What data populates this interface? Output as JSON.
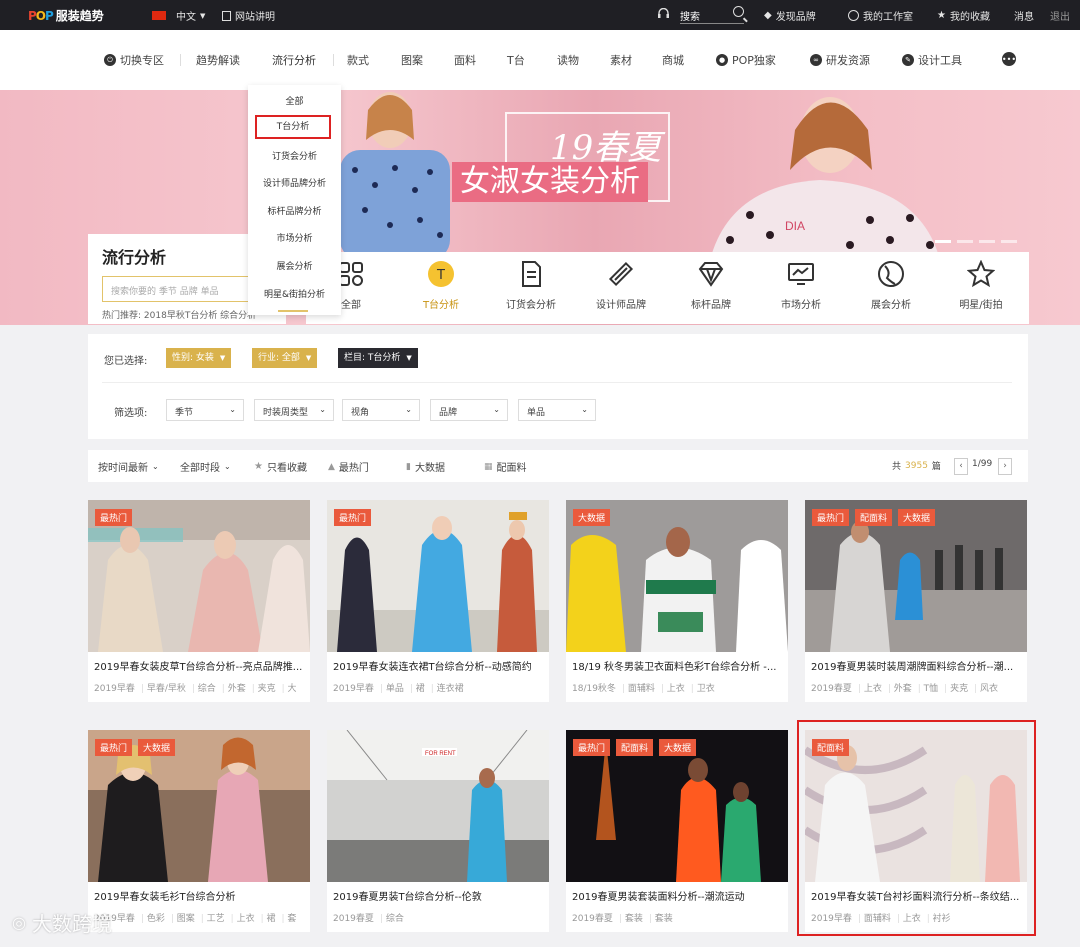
{
  "topbar": {
    "brand": "服装趋势",
    "language": "中文",
    "site_guide": "网站讲明",
    "search_label": "搜索",
    "discover_brand": "发现品牌",
    "my_studio": "我的工作室",
    "my_favorites": "我的收藏",
    "messages": "消息",
    "logout": "退出"
  },
  "nav": {
    "items": [
      "切换专区",
      "趋势解读",
      "流行分析",
      "款式",
      "图案",
      "面料",
      "T台",
      "读物",
      "素材",
      "商城",
      "POP独家",
      "研发资源",
      "设计工具"
    ]
  },
  "dropdown": {
    "items": [
      "全部",
      "T台分析",
      "订货会分析",
      "设计师品牌分析",
      "标杆品牌分析",
      "市场分析",
      "展会分析",
      "明星&街拍分析"
    ]
  },
  "banner": {
    "title_line1": "19春夏",
    "title_line2": "女淑女装分析"
  },
  "category_panel": {
    "title": "流行分析",
    "search_placeholder": "搜索你要的 季节 品牌 单品",
    "hot_prefix": "热门推荐:",
    "hot_items": "2018早秋T台分析  综合分析"
  },
  "categories": [
    "全部",
    "T台分析",
    "订货会分析",
    "设计师品牌",
    "标杆品牌",
    "市场分析",
    "展会分析",
    "明星/街拍"
  ],
  "filters": {
    "selected_label": "您已选择:",
    "selected": [
      "性别: 女装",
      "行业: 全部",
      "栏目: T台分析"
    ],
    "filter_label": "筛选项:",
    "options": [
      "季节",
      "时装周类型",
      "视角",
      "品牌",
      "单品"
    ]
  },
  "sort": {
    "latest": "按时间最新",
    "period": "全部时段",
    "favorites_only": "只看收藏",
    "hottest": "最热门",
    "big_data": "大数据",
    "fabric": "配面料",
    "total_prefix": "共",
    "total": "3955",
    "total_suffix": "篇",
    "page": "1/99"
  },
  "cards": [
    {
      "title": "2019早春女装皮草T台综合分析--亮点品牌推...",
      "badges": [
        "最热门"
      ],
      "tags": [
        "2019早春",
        "早春/早秋",
        "综合",
        "外套",
        "夹克",
        "大"
      ]
    },
    {
      "title": "2019早春女装连衣裙T台综合分析--动感简约",
      "badges": [
        "最热门"
      ],
      "tags": [
        "2019早春",
        "单品",
        "裙",
        "连衣裙"
      ]
    },
    {
      "title": "18/19 秋冬男装卫衣面料色彩T台综合分析 -...",
      "badges": [
        "大数据"
      ],
      "tags": [
        "18/19秋冬",
        "面辅料",
        "上衣",
        "卫衣"
      ]
    },
    {
      "title": "2019春夏男装时装周潮牌面料综合分析--潮...",
      "badges": [
        "最热门",
        "配面料",
        "大数据"
      ],
      "tags": [
        "2019春夏",
        "上衣",
        "外套",
        "T恤",
        "夹克",
        "风衣"
      ]
    },
    {
      "title": "2019早春女装毛衫T台综合分析",
      "badges": [
        "最热门",
        "大数据"
      ],
      "tags": [
        "2019早春",
        "色彩",
        "图案",
        "工艺",
        "上衣",
        "裙",
        "套"
      ]
    },
    {
      "title": "2019春夏男装T台综合分析--伦敦",
      "badges": [],
      "tags": [
        "2019春夏",
        "综合"
      ]
    },
    {
      "title": "2019春夏男装套装面料分析--潮流运动",
      "badges": [
        "最热门",
        "配面料",
        "大数据"
      ],
      "tags": [
        "2019春夏",
        "套装",
        "套装"
      ]
    },
    {
      "title": "2019早春女装T台衬衫面料流行分析--条纹结...",
      "badges": [
        "配面料"
      ],
      "tags": [
        "2019早春",
        "面辅料",
        "上衣",
        "衬衫"
      ]
    }
  ],
  "watermark": "大数跨境",
  "colors": {
    "accent_gold": "#d9b24c",
    "badge_red": "#ea5a3c",
    "highlight_red": "#dd2222",
    "topbar_bg": "#1f1f24"
  }
}
